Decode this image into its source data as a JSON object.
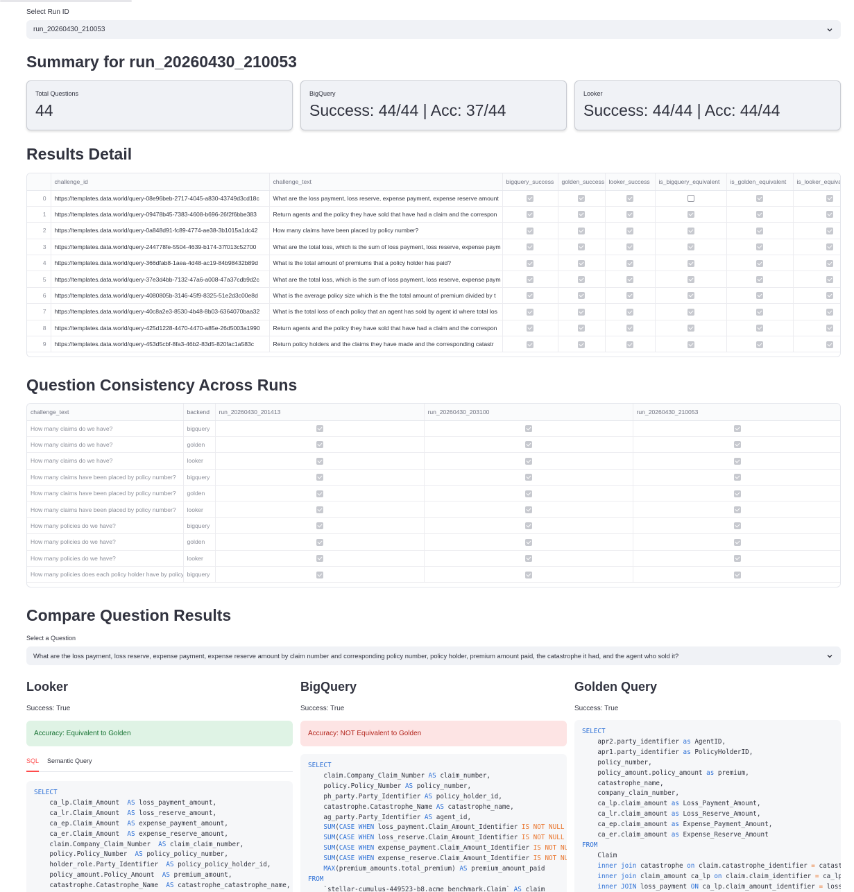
{
  "run_select": {
    "label": "Select Run ID",
    "value": "run_20260430_210053"
  },
  "summary": {
    "title": "Summary for run_20260430_210053",
    "metrics": [
      {
        "label": "Total Questions",
        "value": "44"
      },
      {
        "label": "BigQuery",
        "value": "Success: 44/44 | Acc: 37/44"
      },
      {
        "label": "Looker",
        "value": "Success: 44/44 | Acc: 44/44"
      }
    ]
  },
  "results_detail": {
    "title": "Results Detail",
    "columns": [
      "",
      "challenge_id",
      "challenge_text",
      "bigquery_success",
      "golden_success",
      "looker_success",
      "is_bigquery_equivalent",
      "is_golden_equivalent",
      "is_looker_equiva"
    ],
    "rows": [
      {
        "idx": "0",
        "id": "https://templates.data.world/query-08e96beb-2717-4045-a830-43749d3cd18c",
        "text": "What are the loss payment, loss reserve, expense payment, expense reserve amount",
        "bq": true,
        "golden": true,
        "looker": true,
        "bq_eq": false,
        "golden_eq": true,
        "looker_eq": true
      },
      {
        "idx": "1",
        "id": "https://templates.data.world/query-09478b45-7383-4608-b696-26f2f6bbe383",
        "text": "Return agents and the policy they have sold that have had a claim and the correspon",
        "bq": true,
        "golden": true,
        "looker": true,
        "bq_eq": true,
        "golden_eq": true,
        "looker_eq": true
      },
      {
        "idx": "2",
        "id": "https://templates.data.world/query-0a848d91-fc89-4774-ae38-3b1015a1dc42",
        "text": "How many claims have been placed by policy number?",
        "bq": true,
        "golden": true,
        "looker": true,
        "bq_eq": true,
        "golden_eq": true,
        "looker_eq": true
      },
      {
        "idx": "3",
        "id": "https://templates.data.world/query-244778fe-5504-4639-b174-37f013c52700",
        "text": "What are the total loss, which is the sum of loss payment, loss reserve, expense paym",
        "bq": true,
        "golden": true,
        "looker": true,
        "bq_eq": true,
        "golden_eq": true,
        "looker_eq": true
      },
      {
        "idx": "4",
        "id": "https://templates.data.world/query-366dfab8-1aea-4d48-ac19-84b98432b89d",
        "text": "What is the total amount of premiums that a policy holder has paid?",
        "bq": true,
        "golden": true,
        "looker": true,
        "bq_eq": true,
        "golden_eq": true,
        "looker_eq": true
      },
      {
        "idx": "5",
        "id": "https://templates.data.world/query-37e3d4bb-7132-47a6-a008-47a37cdb9d2c",
        "text": "What are the total loss, which is the sum of loss payment, loss reserve, expense paym",
        "bq": true,
        "golden": true,
        "looker": true,
        "bq_eq": true,
        "golden_eq": true,
        "looker_eq": true
      },
      {
        "idx": "6",
        "id": "https://templates.data.world/query-4080805b-3146-45f9-8325-51e2d3c00e8d",
        "text": "What is the average policy size which is the the total amount of premium divided by t",
        "bq": true,
        "golden": true,
        "looker": true,
        "bq_eq": true,
        "golden_eq": true,
        "looker_eq": true
      },
      {
        "idx": "7",
        "id": "https://templates.data.world/query-40c8a2e3-8530-4b48-8b03-6364070baa32",
        "text": "What is the total loss of each policy that an agent has sold by agent id where total los",
        "bq": true,
        "golden": true,
        "looker": true,
        "bq_eq": true,
        "golden_eq": true,
        "looker_eq": true
      },
      {
        "idx": "8",
        "id": "https://templates.data.world/query-425d1228-4470-4470-a85e-26d5003a1990",
        "text": "Return agents and the policy they have sold that have had a claim and the correspon",
        "bq": true,
        "golden": true,
        "looker": true,
        "bq_eq": true,
        "golden_eq": true,
        "looker_eq": true
      },
      {
        "idx": "9",
        "id": "https://templates.data.world/query-453d5cbf-8fa3-46b2-83d5-820fac1a583c",
        "text": "Return policy holders and the claims they have made and the corresponding catastr",
        "bq": true,
        "golden": true,
        "looker": true,
        "bq_eq": true,
        "golden_eq": true,
        "looker_eq": true
      }
    ]
  },
  "consistency": {
    "title": "Question Consistency Across Runs",
    "columns": [
      "challenge_text",
      "backend",
      "run_20260430_201413",
      "run_20260430_203100",
      "run_20260430_210053"
    ],
    "rows": [
      {
        "text": "How many claims do we have?",
        "backend": "bigquery"
      },
      {
        "text": "How many claims do we have?",
        "backend": "golden"
      },
      {
        "text": "How many claims do we have?",
        "backend": "looker"
      },
      {
        "text": "How many claims have been placed by policy number?",
        "backend": "bigquery"
      },
      {
        "text": "How many claims have been placed by policy number?",
        "backend": "golden"
      },
      {
        "text": "How many claims have been placed by policy number?",
        "backend": "looker"
      },
      {
        "text": "How many policies do we have?",
        "backend": "bigquery"
      },
      {
        "text": "How many policies do we have?",
        "backend": "golden"
      },
      {
        "text": "How many policies do we have?",
        "backend": "looker"
      },
      {
        "text": "How many policies does each policy holder have by policy",
        "backend": "bigquery"
      }
    ]
  },
  "compare": {
    "title": "Compare Question Results",
    "select_label": "Select a Question",
    "select_value": "What are the loss payment, loss reserve, expense payment, expense reserve amount by claim number and corresponding policy number, policy holder, premium amount paid, the catastrophe it had, and the agent who sold it?",
    "looker": {
      "title": "Looker",
      "success": "Success: True",
      "accuracy": "Accuracy: Equivalent to Golden",
      "tabs": [
        "SQL",
        "Semantic Query"
      ],
      "code": [
        [
          [
            "SELECT",
            "kw"
          ]
        ],
        [
          [
            "    ca_lp.Claim_Amount  ",
            ""
          ],
          [
            "AS",
            "kw"
          ],
          [
            " loss_payment_amount,",
            ""
          ]
        ],
        [
          [
            "    ca_lr.Claim_Amount  ",
            ""
          ],
          [
            "AS",
            "kw"
          ],
          [
            " loss_reserve_amount,",
            ""
          ]
        ],
        [
          [
            "    ca_ep.Claim_Amount  ",
            ""
          ],
          [
            "AS",
            "kw"
          ],
          [
            " expense_payment_amount,",
            ""
          ]
        ],
        [
          [
            "    ca_er.Claim_Amount  ",
            ""
          ],
          [
            "AS",
            "kw"
          ],
          [
            " expense_reserve_amount,",
            ""
          ]
        ],
        [
          [
            "    claim.Company_Claim_Number  ",
            ""
          ],
          [
            "AS",
            "kw"
          ],
          [
            " claim_claim_number,",
            ""
          ]
        ],
        [
          [
            "    policy.Policy_Number  ",
            ""
          ],
          [
            "AS",
            "kw"
          ],
          [
            " policy_policy_number,",
            ""
          ]
        ],
        [
          [
            "    holder_role.Party_Identifier  ",
            ""
          ],
          [
            "AS",
            "kw"
          ],
          [
            " policy_policy_holder_id,",
            ""
          ]
        ],
        [
          [
            "    policy_amount.Policy_Amount  ",
            ""
          ],
          [
            "AS",
            "kw"
          ],
          [
            " premium_amount,",
            ""
          ]
        ],
        [
          [
            "    catastrophe.Catastrophe_Name  ",
            ""
          ],
          [
            "AS",
            "kw"
          ],
          [
            " catastrophe_catastrophe_name,",
            ""
          ]
        ]
      ]
    },
    "bigquery": {
      "title": "BigQuery",
      "success": "Success: True",
      "accuracy": "Accuracy: NOT Equivalent to Golden",
      "code": [
        [
          [
            "SELECT",
            "kw"
          ]
        ],
        [
          [
            "    claim.Company_Claim_Number ",
            ""
          ],
          [
            "AS",
            "kw"
          ],
          [
            " claim_number,",
            ""
          ]
        ],
        [
          [
            "    policy.Policy_Number ",
            ""
          ],
          [
            "AS",
            "kw"
          ],
          [
            " policy_number,",
            ""
          ]
        ],
        [
          [
            "    ph_party.Party_Identifier ",
            ""
          ],
          [
            "AS",
            "kw"
          ],
          [
            " policy_holder_id,",
            ""
          ]
        ],
        [
          [
            "    catastrophe.Catastrophe_Name ",
            ""
          ],
          [
            "AS",
            "kw"
          ],
          [
            " catastrophe_name,",
            ""
          ]
        ],
        [
          [
            "    ag_party.Party_Identifier ",
            ""
          ],
          [
            "AS",
            "kw"
          ],
          [
            " agent_id,",
            ""
          ]
        ],
        [
          [
            "    ",
            ""
          ],
          [
            "SUM",
            "kw"
          ],
          [
            "(",
            ""
          ],
          [
            "CASE WHEN",
            "kw"
          ],
          [
            " loss_payment.Claim_Amount_Identifier ",
            ""
          ],
          [
            "IS NOT NULL",
            "op"
          ]
        ],
        [
          [
            "    ",
            ""
          ],
          [
            "SUM",
            "kw"
          ],
          [
            "(",
            ""
          ],
          [
            "CASE WHEN",
            "kw"
          ],
          [
            " loss_reserve.Claim_Amount_Identifier ",
            ""
          ],
          [
            "IS NOT NULL",
            "op"
          ]
        ],
        [
          [
            "    ",
            ""
          ],
          [
            "SUM",
            "kw"
          ],
          [
            "(",
            ""
          ],
          [
            "CASE WHEN",
            "kw"
          ],
          [
            " expense_payment.Claim_Amount_Identifier ",
            ""
          ],
          [
            "IS NOT NU",
            "op"
          ]
        ],
        [
          [
            "    ",
            ""
          ],
          [
            "SUM",
            "kw"
          ],
          [
            "(",
            ""
          ],
          [
            "CASE WHEN",
            "kw"
          ],
          [
            " expense_reserve.Claim_Amount_Identifier ",
            ""
          ],
          [
            "IS NOT NU",
            "op"
          ]
        ],
        [
          [
            "    ",
            ""
          ],
          [
            "MAX",
            "kw"
          ],
          [
            "(premium_amounts.total_premium) ",
            ""
          ],
          [
            "AS",
            "kw"
          ],
          [
            " premium_amount_paid",
            ""
          ]
        ],
        [
          [
            "FROM",
            "kw"
          ]
        ],
        [
          [
            "    `stellar-cumulus-449523-b8.acme_benchmark.Claim` ",
            ""
          ],
          [
            "AS",
            "kw"
          ],
          [
            " claim",
            ""
          ]
        ]
      ]
    },
    "golden": {
      "title": "Golden Query",
      "success": "Success: True",
      "code": [
        [
          [
            "SELECT",
            "kw"
          ]
        ],
        [
          [
            "    apr2.party_identifier ",
            ""
          ],
          [
            "as",
            "kw"
          ],
          [
            " AgentID,",
            ""
          ]
        ],
        [
          [
            "    apr1.party_identifier ",
            ""
          ],
          [
            "as",
            "kw"
          ],
          [
            " PolicyHolderID,",
            ""
          ]
        ],
        [
          [
            "    policy_number,",
            ""
          ]
        ],
        [
          [
            "    policy_amount.policy_amount ",
            ""
          ],
          [
            "as",
            "kw"
          ],
          [
            " premium,",
            ""
          ]
        ],
        [
          [
            "    catastrophe_name,",
            ""
          ]
        ],
        [
          [
            "    company_claim_number,",
            ""
          ]
        ],
        [
          [
            "    ca_lp.claim_amount ",
            ""
          ],
          [
            "as",
            "kw"
          ],
          [
            " Loss_Payment_Amount,",
            ""
          ]
        ],
        [
          [
            "    ca_lr.claim_amount ",
            ""
          ],
          [
            "as",
            "kw"
          ],
          [
            " Loss_Reserve_Amount,",
            ""
          ]
        ],
        [
          [
            "    ca_ep.claim_amount ",
            ""
          ],
          [
            "as",
            "kw"
          ],
          [
            " Expense_Payment_Amount,",
            ""
          ]
        ],
        [
          [
            "    ca_er.claim_amount ",
            ""
          ],
          [
            "as",
            "kw"
          ],
          [
            " Expense_Reserve_Amount",
            ""
          ]
        ],
        [
          [
            "FROM",
            "kw"
          ]
        ],
        [
          [
            "    Claim",
            ""
          ]
        ],
        [
          [
            "    ",
            ""
          ],
          [
            "inner join",
            "kw"
          ],
          [
            " catastrophe ",
            ""
          ],
          [
            "on",
            "kw"
          ],
          [
            " claim.catastrophe_identifier ",
            ""
          ],
          [
            "=",
            "op"
          ],
          [
            " catast",
            ""
          ]
        ],
        [
          [
            "    ",
            ""
          ],
          [
            "inner join",
            "kw"
          ],
          [
            " claim_amount ca_lp ",
            ""
          ],
          [
            "on",
            "kw"
          ],
          [
            " claim.claim_identifier ",
            ""
          ],
          [
            "=",
            "op"
          ],
          [
            " ca_lp",
            ""
          ]
        ],
        [
          [
            "    ",
            ""
          ],
          [
            "inner JOIN",
            "kw"
          ],
          [
            " loss_payment ",
            ""
          ],
          [
            "ON",
            "kw"
          ],
          [
            " ca_lp.claim_amount_identifier ",
            ""
          ],
          [
            "=",
            "op"
          ],
          [
            " loss",
            ""
          ]
        ]
      ]
    }
  }
}
